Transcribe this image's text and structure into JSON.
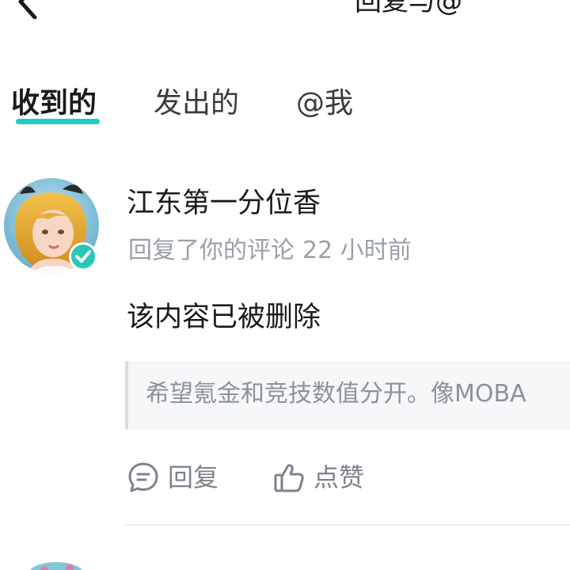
{
  "header": {
    "title": "回复与@"
  },
  "tabs": [
    {
      "label": "收到的",
      "active": true
    },
    {
      "label": "发出的",
      "active": false
    },
    {
      "label": "@我",
      "active": false
    }
  ],
  "colors": {
    "accent": "#1fd0c2",
    "verified": "#29c7b8"
  },
  "comments": [
    {
      "username": "江东第一分位香",
      "action_text": "回复了你的评论",
      "time": "22 小时前",
      "content": "该内容已被删除",
      "quoted_text": "希望氪金和竞技数值分开。像MOBA",
      "reply_label": "回复",
      "like_label": "点赞"
    }
  ]
}
